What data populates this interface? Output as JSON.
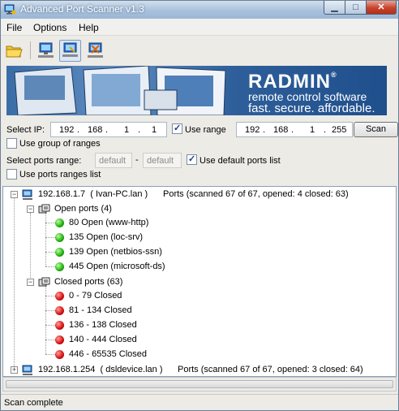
{
  "window": {
    "title": "Advanced Port Scanner v1.3"
  },
  "menu": [
    "File",
    "Options",
    "Help"
  ],
  "toolbar": {
    "buttons": [
      "folder-open-icon",
      "network-computer-icon",
      "network-scan-icon",
      "network-stop-icon"
    ]
  },
  "banner": {
    "brand": "RADMIN",
    "registered": "®",
    "tagline1": "remote control software",
    "tagline2": "fast. secure. affordable."
  },
  "form": {
    "select_ip_label": "Select IP:",
    "ip_start": [
      "192",
      "168",
      "1",
      "1"
    ],
    "use_range_label": "Use range",
    "use_range_checked": true,
    "ip_end": [
      "192",
      "168",
      "1",
      "255"
    ],
    "scan_label": "Scan",
    "use_group_label": "Use group of ranges",
    "use_group_checked": false,
    "ports_range_label": "Select ports range:",
    "port_from": "default",
    "port_separator": "-",
    "port_to": "default",
    "use_default_ports_label": "Use default ports list",
    "use_default_ports_checked": true,
    "use_ports_ranges_label": "Use ports ranges list",
    "use_ports_ranges_checked": false
  },
  "tree": {
    "host1": {
      "expander": "−",
      "ip": "192.168.1.7",
      "name": "( Ivan-PC.lan )",
      "summary": "Ports (scanned 67 of 67, opened: 4 closed: 63)",
      "open_group": {
        "expander": "−",
        "label": "Open ports (4)"
      },
      "open_ports": [
        "80 Open (www-http)",
        "135 Open (loc-srv)",
        "139 Open (netbios-ssn)",
        "445 Open (microsoft-ds)"
      ],
      "closed_group": {
        "expander": "−",
        "label": "Closed ports (63)"
      },
      "closed_ports": [
        "0 - 79 Closed",
        "81 - 134 Closed",
        "136 - 138 Closed",
        "140 - 444 Closed",
        "446 - 65535 Closed"
      ]
    },
    "host2": {
      "expander": "+",
      "ip": "192.168.1.254",
      "name": "( dsldevice.lan )",
      "summary": "Ports (scanned 67 of 67, opened: 3 closed: 64)"
    }
  },
  "status": {
    "text": "Scan complete"
  },
  "colors": {
    "open": "#1fae0f",
    "closed": "#d40f0f",
    "banner": "#2e5f9a"
  }
}
